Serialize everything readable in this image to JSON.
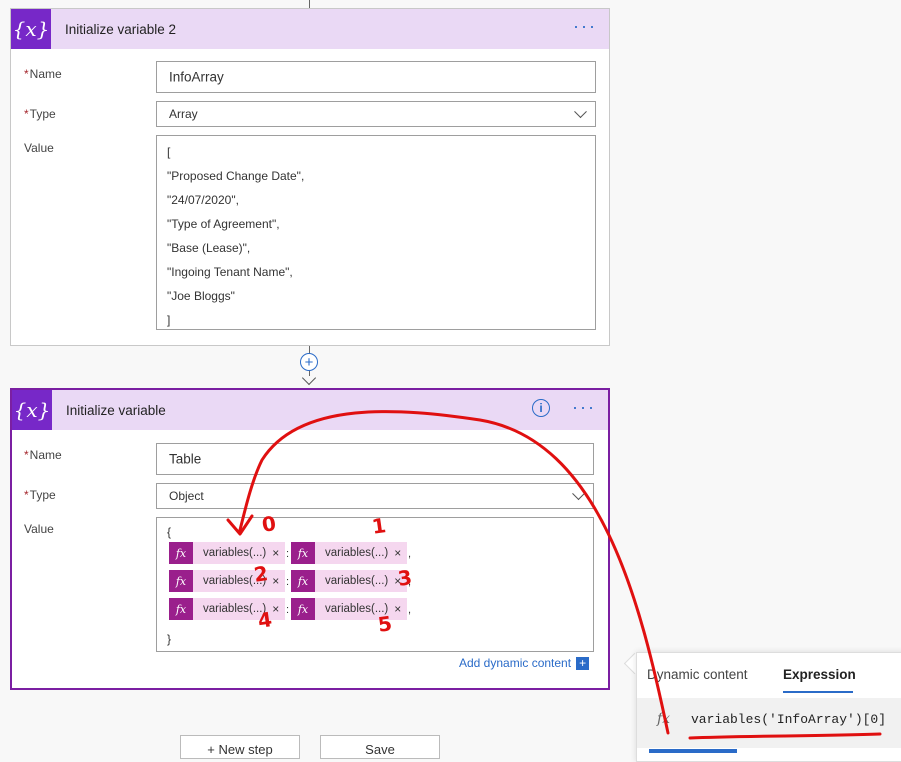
{
  "card1": {
    "title": "Initialize variable 2",
    "icon": "variable-icon",
    "name_label": "Name",
    "name_value": "InfoArray",
    "type_label": "Type",
    "type_value": "Array",
    "value_label": "Value",
    "value_lines": [
      "[",
      "\"Proposed Change Date\",",
      "\"24/07/2020\",",
      "\"Type of Agreement\",",
      "\"Base (Lease)\",",
      "\"Ingoing Tenant Name\",",
      "\"Joe Bloggs\"",
      "]"
    ],
    "more": "···"
  },
  "card2": {
    "title": "Initialize variable",
    "icon": "variable-icon",
    "info": "i",
    "more": "···",
    "name_label": "Name",
    "name_value": "Table",
    "type_label": "Type",
    "type_value": "Object",
    "value_label": "Value",
    "open_brace": "{",
    "close_brace": "}",
    "tokens": [
      {
        "fx": "fx",
        "label": "variables(...)",
        "x": "×"
      },
      {
        "fx": "fx",
        "label": "variables(...)",
        "x": "×"
      },
      {
        "fx": "fx",
        "label": "variables(...)",
        "x": "×"
      },
      {
        "fx": "fx",
        "label": "variables(...)",
        "x": "×"
      },
      {
        "fx": "fx",
        "label": "variables(...)",
        "x": "×"
      },
      {
        "fx": "fx",
        "label": "variables(...)",
        "x": "×"
      }
    ],
    "separators": [
      ":",
      ",",
      ":",
      ",",
      ":",
      ","
    ],
    "add_dynamic": "Add dynamic content",
    "add_dynamic_plus": "+"
  },
  "connector": {
    "plus": "+"
  },
  "bottom_buttons": {
    "new_step": "+ New step",
    "save": "Save"
  },
  "panel": {
    "tab_dynamic": "Dynamic content",
    "tab_expression": "Expression",
    "fx": "fx",
    "expression": "variables('InfoArray')[0]"
  },
  "annotations": [
    "0",
    "1",
    "2",
    "3",
    "4",
    "5"
  ],
  "colors": {
    "accent": "#7728c8",
    "token": "#9a1f8c",
    "link": "#2a6bc8",
    "annotation": "#e01010"
  }
}
